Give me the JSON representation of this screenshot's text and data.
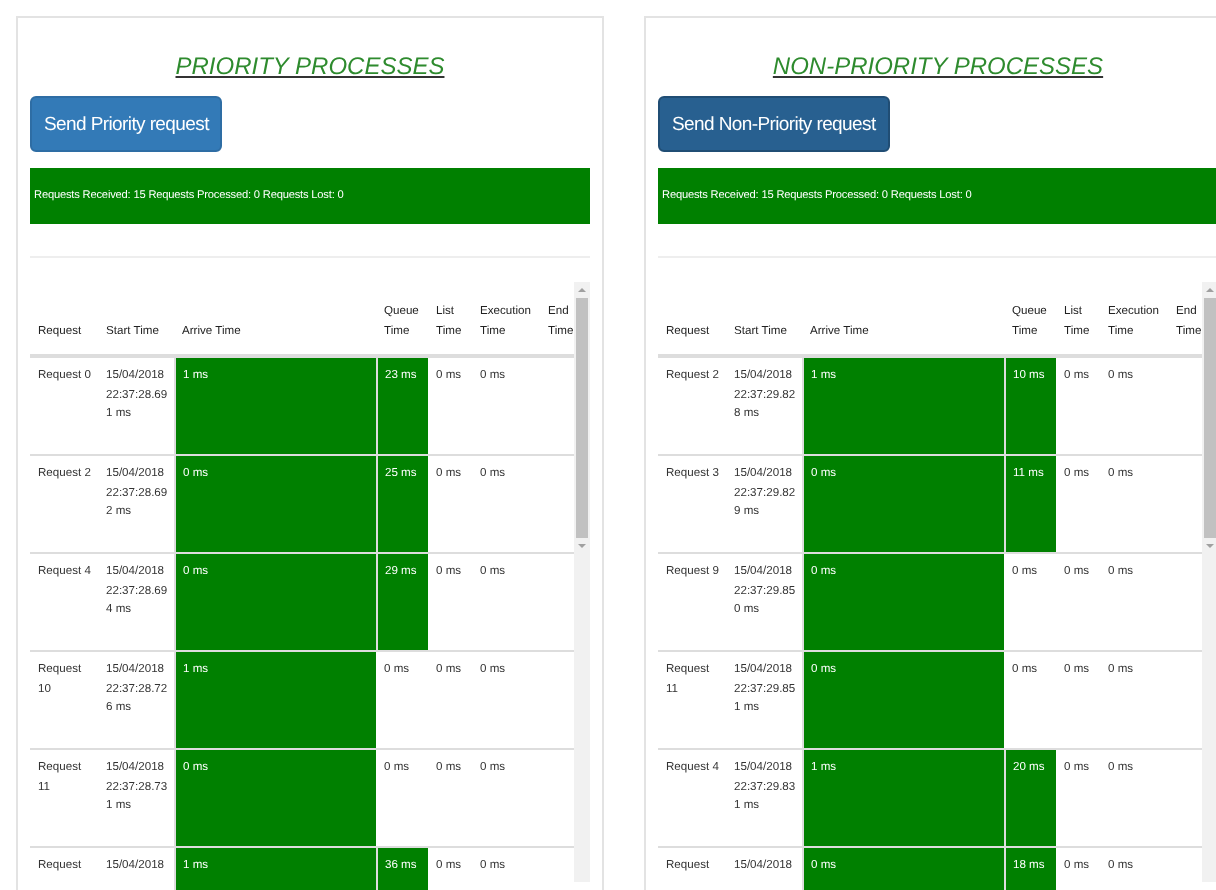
{
  "panels": [
    {
      "title": "PRIORITY PROCESSES",
      "button": {
        "label": "Send Priority request",
        "focused": false
      },
      "status": "Requests Received: 15 Requests Processed: 0 Requests Lost: 0",
      "columns": [
        "Request",
        "Start Time",
        "Arrive Time",
        "Queue Time",
        "List Time",
        "Execution Time",
        "End Time"
      ],
      "rows": [
        {
          "request": "Request 0",
          "start": "15/04/2018 22:37:28.691 ms",
          "arrive": "1 ms",
          "queue": "23 ms",
          "list": "0 ms",
          "execution": "0 ms",
          "arrive_highlighted": true,
          "queue_highlighted": true
        },
        {
          "request": "Request 2",
          "start": "15/04/2018 22:37:28.692 ms",
          "arrive": "0 ms",
          "queue": "25 ms",
          "list": "0 ms",
          "execution": "0 ms",
          "arrive_highlighted": true,
          "queue_highlighted": true
        },
        {
          "request": "Request 4",
          "start": "15/04/2018 22:37:28.694 ms",
          "arrive": "0 ms",
          "queue": "29 ms",
          "list": "0 ms",
          "execution": "0 ms",
          "arrive_highlighted": true,
          "queue_highlighted": true
        },
        {
          "request": "Request 10",
          "start": "15/04/2018 22:37:28.726 ms",
          "arrive": "1 ms",
          "queue": "0 ms",
          "list": "0 ms",
          "execution": "0 ms",
          "arrive_highlighted": true,
          "queue_highlighted": false
        },
        {
          "request": "Request 11",
          "start": "15/04/2018 22:37:28.731 ms",
          "arrive": "0 ms",
          "queue": "0 ms",
          "list": "0 ms",
          "execution": "0 ms",
          "arrive_highlighted": true,
          "queue_highlighted": false
        },
        {
          "request": "Request",
          "start": "15/04/2018",
          "arrive": "1 ms",
          "queue": "36 ms",
          "list": "0 ms",
          "execution": "0 ms",
          "arrive_highlighted": true,
          "queue_highlighted": true
        }
      ]
    },
    {
      "title": "NON-PRIORITY PROCESSES",
      "button": {
        "label": "Send Non-Priority request",
        "focused": true
      },
      "status": "Requests Received: 15 Requests Processed: 0 Requests Lost: 0",
      "columns": [
        "Request",
        "Start Time",
        "Arrive Time",
        "Queue Time",
        "List Time",
        "Execution Time",
        "End Time"
      ],
      "rows": [
        {
          "request": "Request 2",
          "start": "15/04/2018 22:37:29.828 ms",
          "arrive": "1 ms",
          "queue": "10 ms",
          "list": "0 ms",
          "execution": "0 ms",
          "arrive_highlighted": true,
          "queue_highlighted": true
        },
        {
          "request": "Request 3",
          "start": "15/04/2018 22:37:29.829 ms",
          "arrive": "0 ms",
          "queue": "11 ms",
          "list": "0 ms",
          "execution": "0 ms",
          "arrive_highlighted": true,
          "queue_highlighted": true
        },
        {
          "request": "Request 9",
          "start": "15/04/2018 22:37:29.850 ms",
          "arrive": "0 ms",
          "queue": "0 ms",
          "list": "0 ms",
          "execution": "0 ms",
          "arrive_highlighted": true,
          "queue_highlighted": false
        },
        {
          "request": "Request 11",
          "start": "15/04/2018 22:37:29.851 ms",
          "arrive": "0 ms",
          "queue": "0 ms",
          "list": "0 ms",
          "execution": "0 ms",
          "arrive_highlighted": true,
          "queue_highlighted": false
        },
        {
          "request": "Request 4",
          "start": "15/04/2018 22:37:29.831 ms",
          "arrive": "1 ms",
          "queue": "20 ms",
          "list": "0 ms",
          "execution": "0 ms",
          "arrive_highlighted": true,
          "queue_highlighted": true
        },
        {
          "request": "Request",
          "start": "15/04/2018",
          "arrive": "0 ms",
          "queue": "18 ms",
          "list": "0 ms",
          "execution": "0 ms",
          "arrive_highlighted": true,
          "queue_highlighted": true
        }
      ]
    }
  ]
}
